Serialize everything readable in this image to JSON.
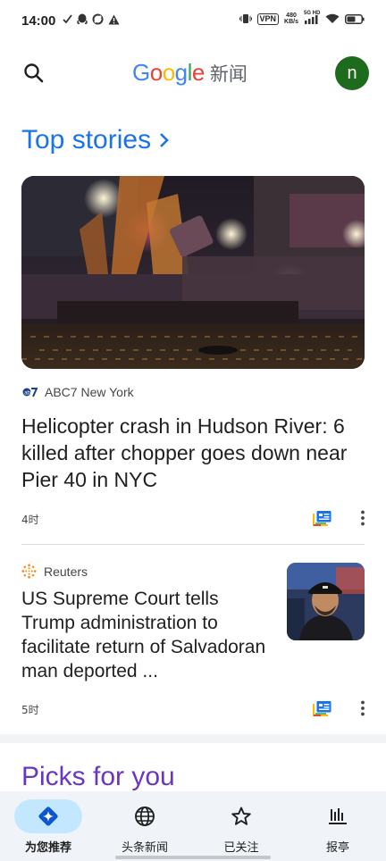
{
  "status_bar": {
    "time": "14:00",
    "vpn": "VPN",
    "net_speed_value": "480",
    "net_speed_unit": "KB/s",
    "network_type": "5G HD"
  },
  "header": {
    "logo_letters": [
      "G",
      "o",
      "o",
      "g",
      "l",
      "e"
    ],
    "logo_colors": [
      "#4285f4",
      "#ea4335",
      "#fbbc05",
      "#4285f4",
      "#34a853",
      "#ea4335"
    ],
    "news_label": "新闻",
    "avatar_initial": "n",
    "avatar_color": "#1e6b1e"
  },
  "top_stories": {
    "title": "Top stories",
    "title_color": "#1a73e8"
  },
  "articles": [
    {
      "source": "ABC7 New York",
      "headline": "Helicopter crash in Hudson River: 6 killed after chopper goes down near Pier 40 in NYC",
      "time": "4时"
    },
    {
      "source": "Reuters",
      "headline": "US Supreme Court tells Trump administration to facilitate return of Salvadoran man deported ...",
      "time": "5时"
    }
  ],
  "picks": {
    "title": "Picks for you",
    "title_color": "#6936c4"
  },
  "bottom_nav": {
    "items": [
      {
        "label": "为您推荐",
        "icon": "for-you-sparkle-icon",
        "active": true
      },
      {
        "label": "头条新闻",
        "icon": "globe-icon",
        "active": false
      },
      {
        "label": "已关注",
        "icon": "star-icon",
        "active": false
      },
      {
        "label": "报亭",
        "icon": "newsstand-icon",
        "active": false
      }
    ]
  }
}
